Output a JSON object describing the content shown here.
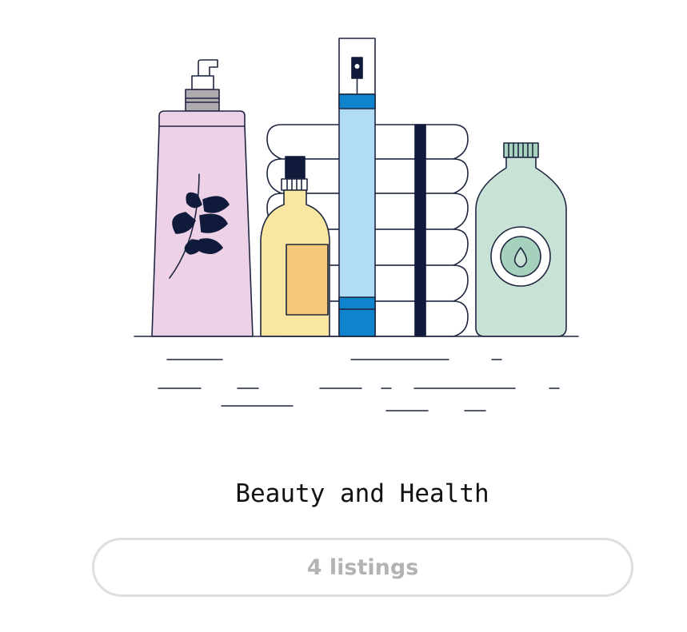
{
  "category": {
    "title": "Beauty and Health",
    "listings_label": "4 listings",
    "illustration_icon": "beauty-health-products-illustration"
  },
  "colors": {
    "pink_bottle": "#ecd1e7",
    "yellow_bottle": "#f9e6a1",
    "yellow_label": "#f4c977",
    "blue_tube": "#b1dcf5",
    "blue_band": "#0f84cc",
    "green_bottle": "#c8e2d6",
    "green_badge": "#a6d2bd",
    "outline": "#1f2640",
    "dark": "#101a3a",
    "pill_border": "#dedede",
    "pill_text": "#b3b3b3"
  }
}
